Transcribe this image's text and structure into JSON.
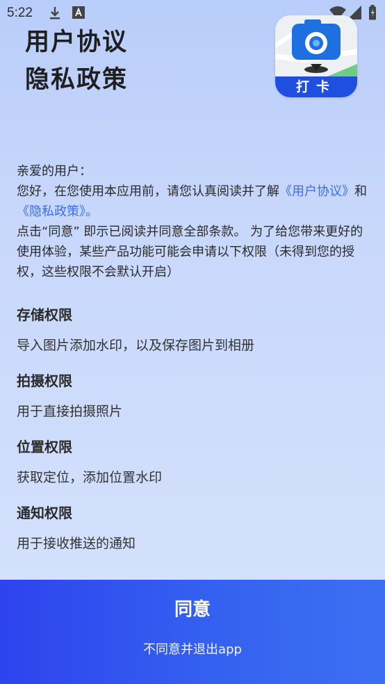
{
  "status_bar": {
    "time": "5:22",
    "icons": [
      "download-icon",
      "font-notification-icon",
      "wifi-icon",
      "signal-icon",
      "battery-icon"
    ]
  },
  "header": {
    "title_line1": "用户协议",
    "title_line2": "隐私政策",
    "app_icon_label": "打卡"
  },
  "intro": {
    "greeting": "亲爱的用户：",
    "p1_prefix": "您好，在您使用本应用前，请您认真阅读并了解",
    "user_agreement_link": "《用户协议》",
    "p1_and": "和",
    "privacy_policy_link": "《隐私政策》",
    "p1_suffix": "。",
    "p2": "点击“同意” 即示已阅读并同意全部条款。 为了给您带来更好的使用体验，某些产品功能可能会申请以下权限（未得到您的授权，这些权限不会默认开启）"
  },
  "permissions": [
    {
      "title": "存储权限",
      "desc": "导入图片添加水印，以及保存图片到相册"
    },
    {
      "title": "拍摄权限",
      "desc": "用于直接拍摄照片"
    },
    {
      "title": "位置权限",
      "desc": "获取定位，添加位置水印"
    },
    {
      "title": "通知权限",
      "desc": "用于接收推送的通知"
    }
  ],
  "actions": {
    "agree_label": "同意",
    "exit_label": "不同意并退出app"
  },
  "colors": {
    "link": "#3a6ee8",
    "bottom_bar": "#3461f0",
    "app_icon_brand": "#1f4fe0"
  }
}
